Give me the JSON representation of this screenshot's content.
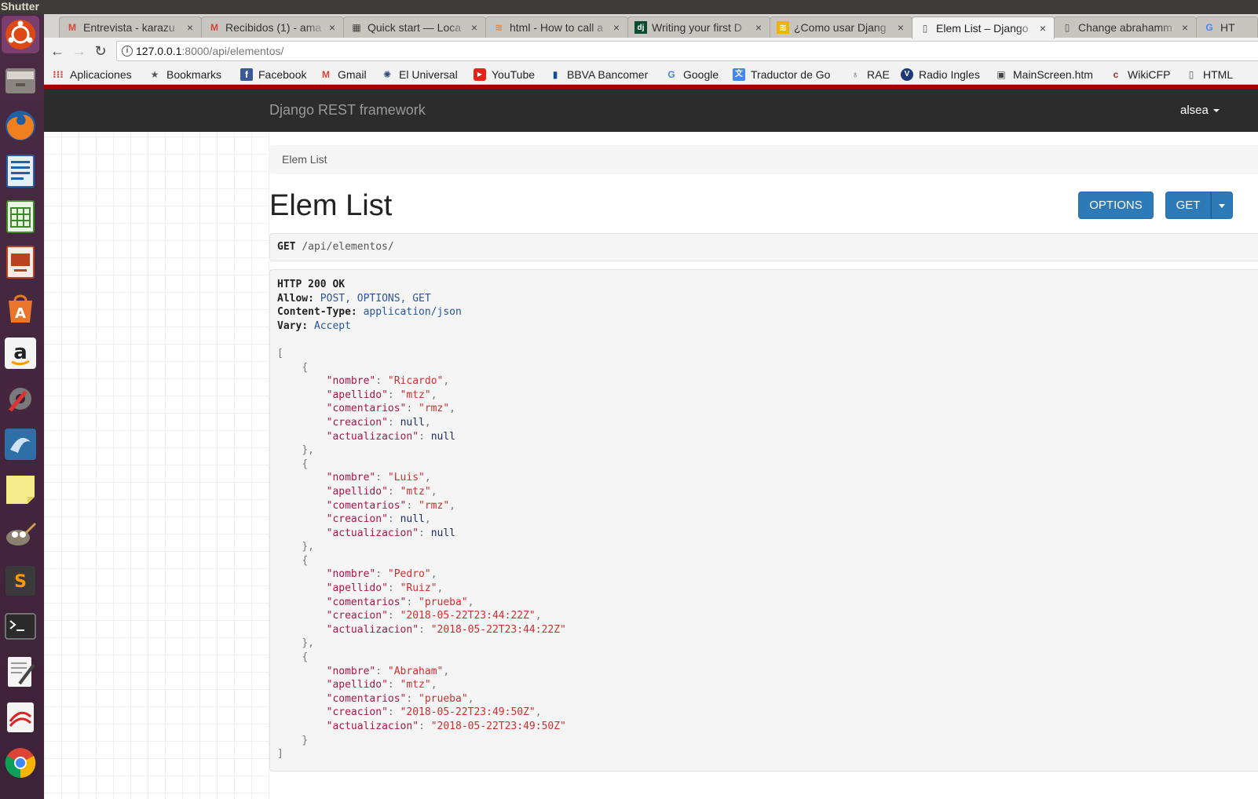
{
  "os": {
    "app_name": "Shutter"
  },
  "launcher": {
    "items": [
      "ubuntu-icon",
      "files-icon",
      "firefox-icon",
      "writer-icon",
      "calc-icon",
      "impress-icon",
      "software-center-icon",
      "amazon-icon",
      "settings-icon",
      "shotwell-icon",
      "sticky-notes-icon",
      "gimp-icon",
      "sublime-icon",
      "terminal-icon",
      "text-editor-icon",
      "document-viewer-icon",
      "chrome-icon"
    ]
  },
  "browser": {
    "tabs": [
      {
        "title": "Entrevista - karazu",
        "icon": "M",
        "icon_color": "#d44638"
      },
      {
        "title": "Recibidos (1) - ama",
        "icon": "M",
        "icon_color": "#d44638"
      },
      {
        "title": "Quick start — Loca",
        "icon": "▦",
        "icon_color": "#444444"
      },
      {
        "title": "html - How to call a",
        "icon": "≋",
        "icon_color": "#f48024"
      },
      {
        "title": "Writing your first D",
        "icon": "dj",
        "icon_color": "#0c4b33"
      },
      {
        "title": "¿Como usar Djang",
        "icon": "≋",
        "icon_color": "#f2b200"
      },
      {
        "title": "Elem List – Django",
        "icon": "▯",
        "icon_color": "#555555"
      },
      {
        "title": "Change abrahamm",
        "icon": "▯",
        "icon_color": "#555555"
      },
      {
        "title": "HT",
        "icon": "G",
        "icon_color": "#4285f4"
      }
    ],
    "active_tab_index": 6,
    "close_glyph": "×",
    "url_host": "127.0.0.1",
    "url_rest": ":8000/api/elementos/",
    "back_glyph": "←",
    "forward_glyph": "→",
    "reload_glyph": "↻",
    "bookmarks": [
      {
        "label": "Aplicaciones",
        "icon": "⁝⁝⁝",
        "icon_color": "#e04a3f"
      },
      {
        "label": "Bookmarks",
        "icon": "★",
        "icon_color": "#555555"
      },
      {
        "label": "Facebook",
        "icon": "f",
        "icon_color": "#3b5998"
      },
      {
        "label": "Gmail",
        "icon": "M",
        "icon_color": "#d44638"
      },
      {
        "label": "El Universal",
        "icon": "✺",
        "icon_color": "#2a4a7a"
      },
      {
        "label": "YouTube",
        "icon": "▶",
        "icon_color": "#e62117"
      },
      {
        "label": "BBVA Bancomer",
        "icon": "▮",
        "icon_color": "#0a4aa0"
      },
      {
        "label": "Google",
        "icon": "G",
        "icon_color": "#4285f4"
      },
      {
        "label": "Traductor de Go",
        "icon": "文",
        "icon_color": "#4285f4"
      },
      {
        "label": "RAE",
        "icon": "♁",
        "icon_color": "#555555"
      },
      {
        "label": "Radio Ingles",
        "icon": "V",
        "icon_color": "#1a3a7a"
      },
      {
        "label": "MainScreen.htm",
        "icon": "▣",
        "icon_color": "#444444"
      },
      {
        "label": "WikiCFP",
        "icon": "c",
        "icon_color": "#a0302a"
      },
      {
        "label": "HTML",
        "icon": "▯",
        "icon_color": "#555555"
      }
    ]
  },
  "page": {
    "brand": "Django REST framework",
    "user": "alsea",
    "breadcrumb": "Elem List",
    "title": "Elem List",
    "buttons": {
      "options": "OPTIONS",
      "get": "GET"
    },
    "request": {
      "method": "GET",
      "path": "/api/elementos/"
    },
    "response_headers": [
      {
        "key": "HTTP 200 OK",
        "value": ""
      },
      {
        "key": "Allow:",
        "value": "POST, OPTIONS, GET"
      },
      {
        "key": "Content-Type:",
        "value": "application/json"
      },
      {
        "key": "Vary:",
        "value": "Accept"
      }
    ],
    "response_body": [
      {
        "nombre": "Ricardo",
        "apellido": "mtz",
        "comentarios": "rmz",
        "creacion": null,
        "actualizacion": null
      },
      {
        "nombre": "Luis",
        "apellido": "mtz",
        "comentarios": "rmz",
        "creacion": null,
        "actualizacion": null
      },
      {
        "nombre": "Pedro",
        "apellido": "Ruiz",
        "comentarios": "prueba",
        "creacion": "2018-05-22T23:44:22Z",
        "actualizacion": "2018-05-22T23:44:22Z"
      },
      {
        "nombre": "Abraham",
        "apellido": "mtz",
        "comentarios": "prueba",
        "creacion": "2018-05-22T23:49:50Z",
        "actualizacion": "2018-05-22T23:49:50Z"
      }
    ]
  }
}
